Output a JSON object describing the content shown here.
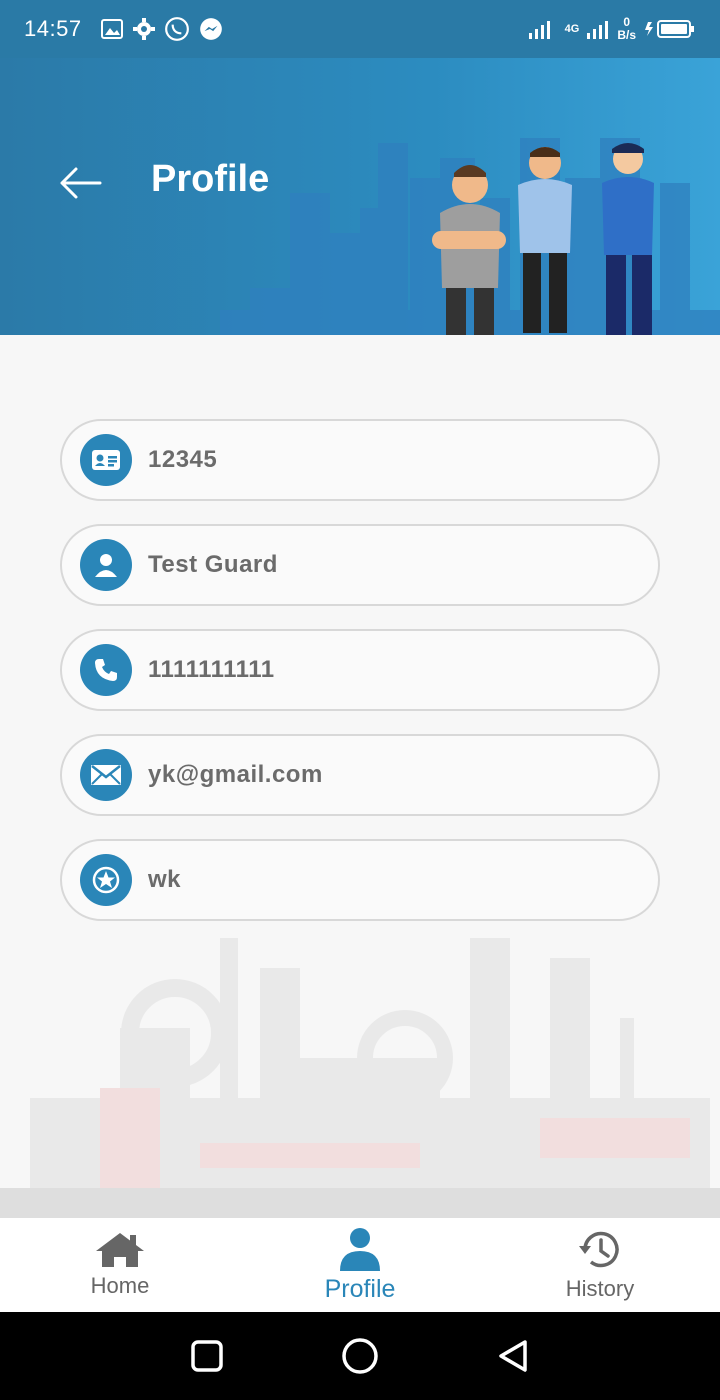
{
  "status_bar": {
    "time": "14:57",
    "network": "4G",
    "speed_value": "0",
    "speed_unit": "B/s"
  },
  "header": {
    "title": "Profile"
  },
  "fields": [
    {
      "name": "id",
      "icon": "id-card-icon",
      "value": "12345"
    },
    {
      "name": "name",
      "icon": "person-icon",
      "value": "Test Guard"
    },
    {
      "name": "phone",
      "icon": "phone-icon",
      "value": "1111111111"
    },
    {
      "name": "email",
      "icon": "mail-icon",
      "value": "yk@gmail.com"
    },
    {
      "name": "rank",
      "icon": "star-badge-icon",
      "value": "wk"
    }
  ],
  "bottom_nav": {
    "items": [
      {
        "label": "Home",
        "icon": "home-icon",
        "active": false
      },
      {
        "label": "Profile",
        "icon": "profile-icon",
        "active": true
      },
      {
        "label": "History",
        "icon": "history-icon",
        "active": false
      }
    ]
  },
  "colors": {
    "accent": "#2a86b8",
    "header": "#2b7aa8",
    "field_text": "#6b6b6b"
  }
}
